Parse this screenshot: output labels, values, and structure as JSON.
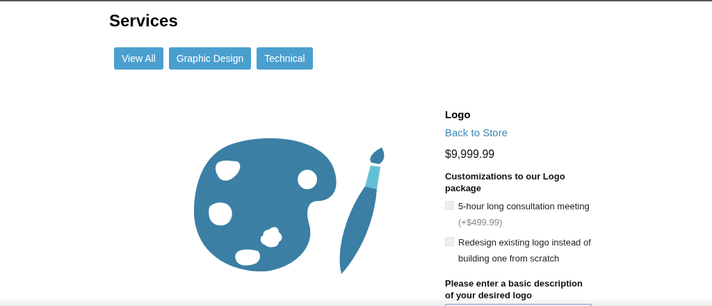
{
  "heading": "Services",
  "filters": [
    {
      "label": "View All"
    },
    {
      "label": "Graphic Design"
    },
    {
      "label": "Technical"
    }
  ],
  "product": {
    "image": {
      "kind": "illustration"
    },
    "name": "Logo",
    "back_link": "Back to Store",
    "price": "$9,999.99",
    "customizations_title": "Customizations to our Logo package",
    "options": [
      {
        "label": "5-hour long consultation meeting",
        "extra": "(+$499.99)",
        "checked": false
      },
      {
        "label": "Redesign existing logo instead of building one from scratch",
        "checked": false
      }
    ],
    "description_label": "Please enter a basic description of your desired logo"
  }
}
